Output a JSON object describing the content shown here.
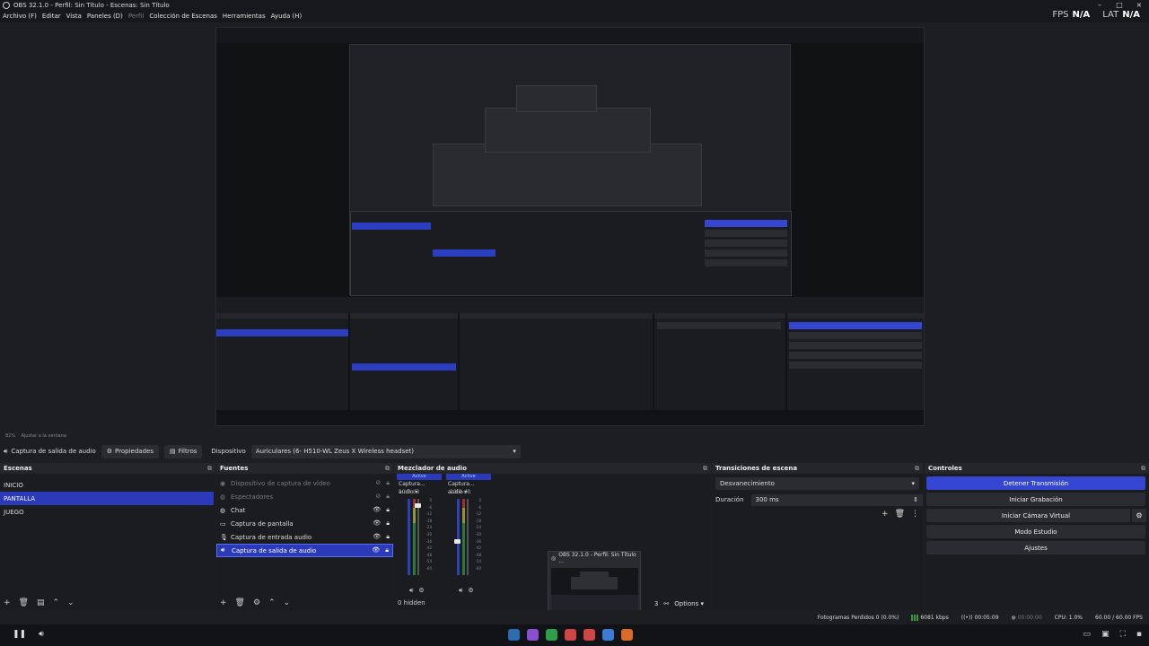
{
  "window": {
    "title": "OBS 32.1.0 - Perfil: Sin Título - Escenas: Sin Título",
    "controls": [
      "–",
      "□",
      "×"
    ]
  },
  "menu": {
    "items": [
      "Archivo (F)",
      "Editar",
      "Vista",
      "Paneles (D)",
      "Perfil",
      "Colección de Escenas",
      "Herramientas",
      "Ayuda (H)"
    ]
  },
  "stats": {
    "fps_label": "FPS",
    "fps_value": "N/A",
    "lat_label": "LAT",
    "lat_value": "N/A"
  },
  "zoom": {
    "percent": "82%",
    "fit_label": "Ajustar a la ventana"
  },
  "source_toolbar": {
    "source_name": "Captura de salida de audio",
    "properties_label": "Propiedades",
    "filters_label": "Filtros",
    "device_label": "Dispositivo",
    "device_value": "Auriculares (6- H510-WL Zeus X Wireless headset)"
  },
  "scenes": {
    "title": "Escenas",
    "items": [
      "INICIO",
      "PANTALLA",
      "JUEGO"
    ],
    "selected": "PANTALLA"
  },
  "sources": {
    "title": "Fuentes",
    "items": [
      {
        "label": "Dispositivo de captura de vídeo",
        "icon": "camera-icon"
      },
      {
        "label": "Espectadores",
        "icon": "browser-icon"
      },
      {
        "label": "Chat",
        "icon": "browser-icon"
      },
      {
        "label": "Captura de pantalla",
        "icon": "monitor-icon"
      },
      {
        "label": "Captura de entrada audio",
        "icon": "microphone-icon"
      },
      {
        "label": "Captura de salida de audio",
        "icon": "speaker-icon"
      }
    ]
  },
  "mixer": {
    "title": "Mezclador de audio",
    "channels": [
      {
        "status": "Active",
        "name": "Captura... audio",
        "db": "10.0 dB",
        "level": 0.92
      },
      {
        "status": "Active",
        "name": "Captura... audio",
        "db": "-20.0 dB",
        "level": 0.45
      }
    ],
    "ticks": [
      "0",
      "-6",
      "-12",
      "-18",
      "-24",
      "-30",
      "-36",
      "-42",
      "-48",
      "-54",
      "-60"
    ],
    "hidden_label": "0 hidden"
  },
  "transitions": {
    "title": "Transiciones de escena",
    "selected": "Desvanecimiento",
    "duration_label": "Duración",
    "duration_value": "300 ms"
  },
  "controls": {
    "title": "Controles",
    "stop_stream": "Detener Transmisión",
    "start_recording": "Iniciar Grabación",
    "start_virtual_cam": "Iniciar Cámara Virtual",
    "studio_mode": "Modo Estudio",
    "settings": "Ajustes"
  },
  "thumbnail": {
    "title": "OBS 32.1.0 - Perfil: Sin Título ...",
    "options_label": "Options",
    "number": "3"
  },
  "status": {
    "dropped_frames": "Fotogramas Perdidos 0 (0.0%)",
    "bitrate": "6081 kbps",
    "stream_time": "00:05:09",
    "rec_time": "00:00:00",
    "cpu": "CPU: 1.0%",
    "fps": "60.00 / 60.00 FPS"
  },
  "taskbar_apps": [
    "#2b6cb0",
    "#8a4fd0",
    "#2f9e4a",
    "#d04545",
    "#d04545",
    "#3a7bd5",
    "#d86a2a"
  ]
}
